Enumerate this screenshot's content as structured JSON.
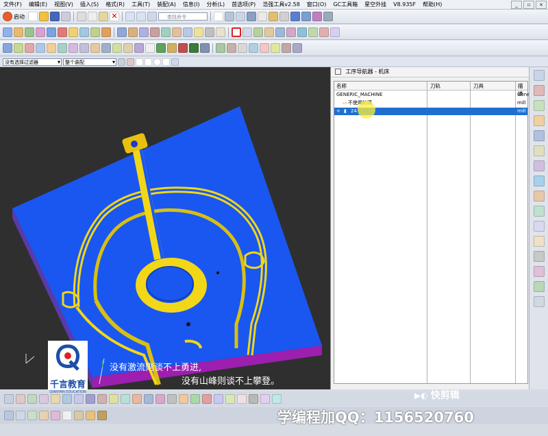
{
  "menu": {
    "items": [
      "文件(F)",
      "编辑(E)",
      "视图(V)",
      "插入(S)",
      "格式(R)",
      "工具(T)",
      "装配(A)",
      "信息(I)",
      "分析(L)",
      "首选项(P)",
      "浩强工具v2.58",
      "窗口(O)",
      "GC工具箱",
      "星空外挂",
      "V8.935F",
      "帮助(H)"
    ]
  },
  "toolbar": {
    "start_label": "启动",
    "command_finder_placeholder": "查找命令",
    "filter_select": "没有选择过滤器",
    "assembly_select": "整个装配"
  },
  "navigator": {
    "title": "工序导航器 - 机床",
    "columns": [
      "名称",
      "刀轨",
      "刀具",
      "描述"
    ],
    "rows": [
      {
        "name": "GENERIC_MACHINE",
        "desc": "Gene"
      },
      {
        "name": "不使用的项",
        "desc": "mill"
      },
      {
        "name": "24",
        "desc": "mill"
      }
    ]
  },
  "overlay": {
    "subtitle_line1": "没有激流则谈不上勇进,",
    "subtitle_line2": "没有山峰则谈不上攀登。",
    "logo_name": "千言教育",
    "logo_sub": "QIANYAN EDUCATION",
    "watermark": "学编程加QQ：1156520760",
    "app_watermark": "快剪辑"
  },
  "colors": {
    "part_top": "#1a57f0",
    "part_side": "#9c1fb0",
    "feature": "#f2d718",
    "viewport_bg": "#2f2f2f",
    "selection": "#1f6fd0"
  }
}
